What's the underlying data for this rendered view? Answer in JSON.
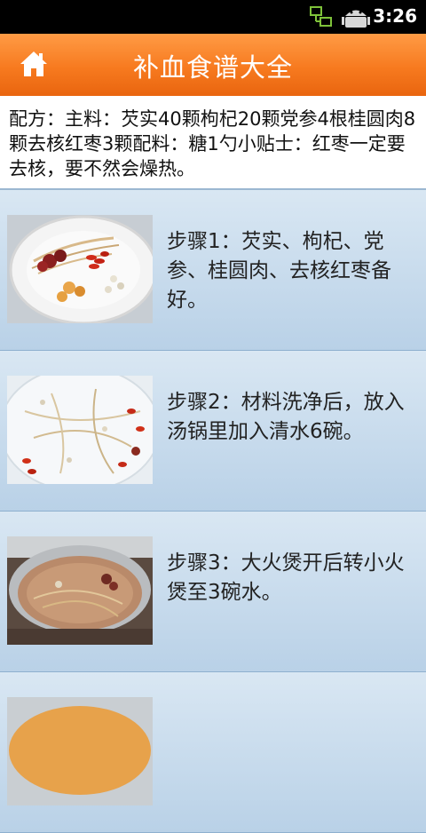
{
  "status_bar": {
    "time": "3:26",
    "icons": [
      "network-icon",
      "android-robot-icon"
    ]
  },
  "header": {
    "title": "补血食谱大全",
    "home_icon": "home-icon"
  },
  "recipe": {
    "text": "配方：主料：芡实40颗枸杞20颗党参4根桂圆肉8颗去核红枣3颗配料：糖1勺小贴士：红枣一定要去核，要不然会燥热。"
  },
  "steps": [
    {
      "text": "步骤1：芡实、枸杞、党参、桂圆肉、去核红枣备好。",
      "image": "step-1-photo"
    },
    {
      "text": "步骤2：材料洗净后，放入汤锅里加入清水6碗。",
      "image": "step-2-photo"
    },
    {
      "text": "步骤3：大火煲开后转小火煲至3碗水。",
      "image": "step-3-photo"
    }
  ],
  "colors": {
    "header": "#f77a1f",
    "background": "#b8d0e6",
    "status_bar": "#000000"
  }
}
